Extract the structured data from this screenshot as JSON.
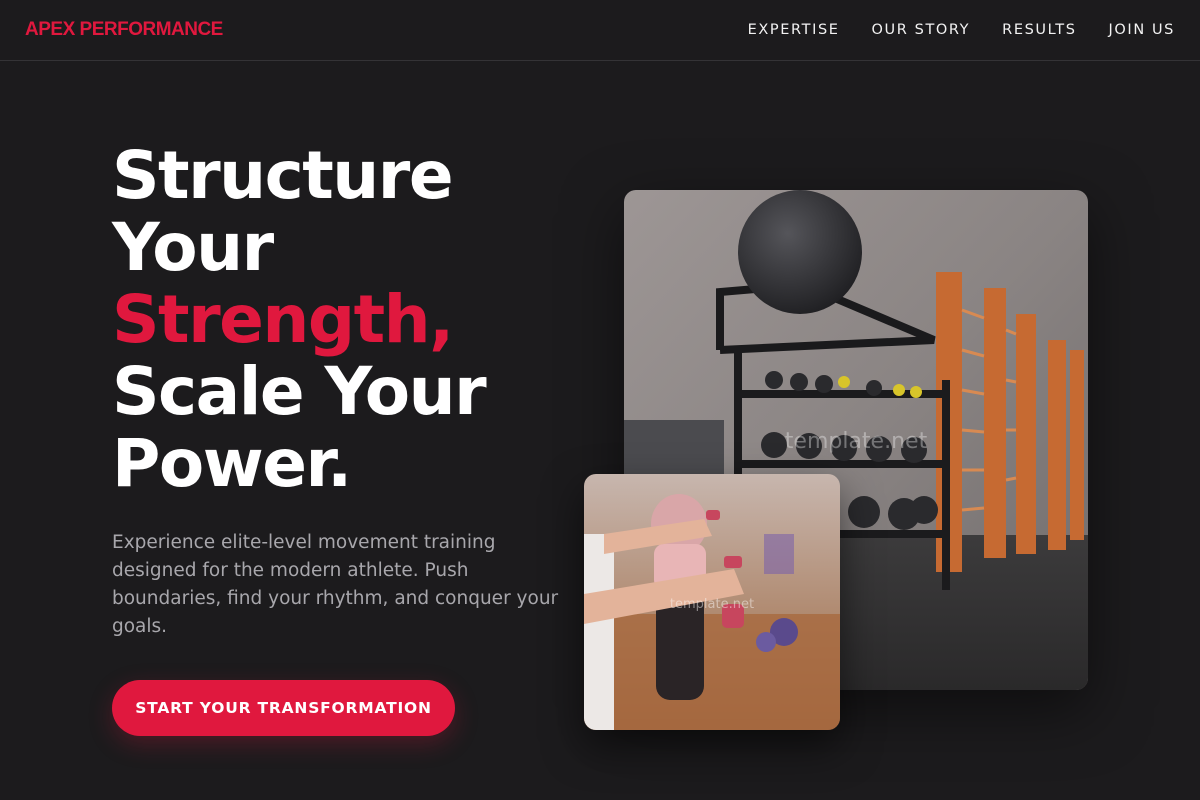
{
  "header": {
    "logo": "APEX PERFORMANCE",
    "nav": [
      "EXPERTISE",
      "OUR STORY",
      "RESULTS",
      "JOIN US"
    ]
  },
  "hero": {
    "title_lines": [
      "Structure",
      "Your",
      "Strength,",
      "Scale Your",
      "Power."
    ],
    "description": "Experience elite-level movement training designed for the modern athlete. Push boundaries, find your rhythm, and conquer your goals.",
    "cta_label": "START YOUR TRANSFORMATION"
  },
  "images": {
    "main_watermark": "template.net",
    "small_watermark": "template.net"
  },
  "colors": {
    "background": "#1c1b1d",
    "accent": "#e0183e",
    "text": "#ffffff",
    "muted_text": "#a8a7ac"
  }
}
